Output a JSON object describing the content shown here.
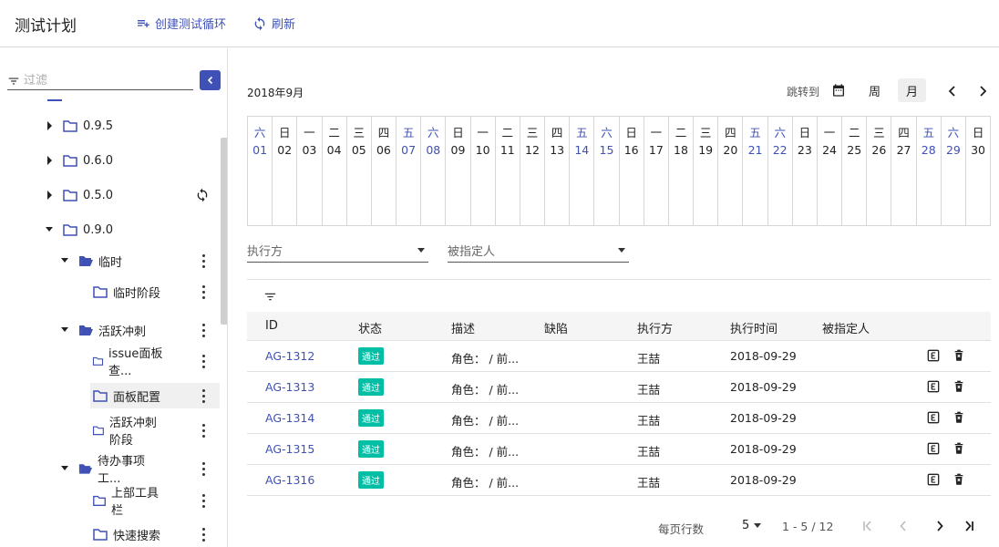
{
  "header": {
    "title": "测试计划",
    "create_cycle": "创建测试循环",
    "refresh": "刷新"
  },
  "sidebar": {
    "filter_placeholder": "过滤",
    "tree": [
      {
        "label": "0.9.5",
        "level": 1,
        "expanded": false
      },
      {
        "label": "0.6.0",
        "level": 1,
        "expanded": false
      },
      {
        "label": "0.5.0",
        "level": 1,
        "expanded": false
      },
      {
        "label": "0.9.0",
        "level": 1,
        "expanded": true
      },
      {
        "label": "临时",
        "level": 2,
        "expanded": true
      },
      {
        "label": "临时阶段",
        "level": 3
      },
      {
        "label": "活跃冲刺",
        "level": 2,
        "expanded": true
      },
      {
        "label": "issue面板查...",
        "level": 3
      },
      {
        "label": "面板配置",
        "level": 3,
        "selected": true
      },
      {
        "label": "活跃冲刺阶段",
        "level": 3
      },
      {
        "label": "待办事项工...",
        "level": 2,
        "expanded": true
      },
      {
        "label": "上部工具栏",
        "level": 3
      },
      {
        "label": "快速搜索",
        "level": 3
      }
    ]
  },
  "calendar": {
    "month": "2018年9月",
    "jump_to": "跳转到",
    "view_week": "周",
    "view_month": "月",
    "days": [
      {
        "w": "六",
        "d": "01",
        "weekend": true
      },
      {
        "w": "日",
        "d": "02",
        "weekend": false
      },
      {
        "w": "一",
        "d": "03",
        "weekend": false
      },
      {
        "w": "二",
        "d": "04",
        "weekend": false
      },
      {
        "w": "三",
        "d": "05",
        "weekend": false
      },
      {
        "w": "四",
        "d": "06",
        "weekend": false
      },
      {
        "w": "五",
        "d": "07",
        "weekend": true
      },
      {
        "w": "六",
        "d": "08",
        "weekend": true
      },
      {
        "w": "日",
        "d": "09",
        "weekend": false
      },
      {
        "w": "一",
        "d": "10",
        "weekend": false
      },
      {
        "w": "二",
        "d": "11",
        "weekend": false
      },
      {
        "w": "三",
        "d": "12",
        "weekend": false
      },
      {
        "w": "四",
        "d": "13",
        "weekend": false
      },
      {
        "w": "五",
        "d": "14",
        "weekend": true
      },
      {
        "w": "六",
        "d": "15",
        "weekend": true
      },
      {
        "w": "日",
        "d": "16",
        "weekend": false
      },
      {
        "w": "一",
        "d": "17",
        "weekend": false
      },
      {
        "w": "二",
        "d": "18",
        "weekend": false
      },
      {
        "w": "三",
        "d": "19",
        "weekend": false
      },
      {
        "w": "四",
        "d": "20",
        "weekend": false
      },
      {
        "w": "五",
        "d": "21",
        "weekend": true
      },
      {
        "w": "六",
        "d": "22",
        "weekend": true
      },
      {
        "w": "日",
        "d": "23",
        "weekend": false
      },
      {
        "w": "一",
        "d": "24",
        "weekend": false
      },
      {
        "w": "二",
        "d": "25",
        "weekend": false
      },
      {
        "w": "三",
        "d": "26",
        "weekend": false
      },
      {
        "w": "四",
        "d": "27",
        "weekend": false
      },
      {
        "w": "五",
        "d": "28",
        "weekend": true
      },
      {
        "w": "六",
        "d": "29",
        "weekend": true
      },
      {
        "w": "日",
        "d": "30",
        "weekend": false
      }
    ]
  },
  "filters": {
    "executor": "执行方",
    "assignee": "被指定人"
  },
  "table": {
    "headers": [
      "ID",
      "状态",
      "描述",
      "缺陷",
      "执行方",
      "执行时间",
      "被指定人"
    ],
    "rows": [
      {
        "id": "AG-1312",
        "status": "通过",
        "desc": "角色： / 前...",
        "defect": "",
        "executor": "王喆",
        "time": "2018-09-29",
        "assignee": ""
      },
      {
        "id": "AG-1313",
        "status": "通过",
        "desc": "角色： / 前...",
        "defect": "",
        "executor": "王喆",
        "time": "2018-09-29",
        "assignee": ""
      },
      {
        "id": "AG-1314",
        "status": "通过",
        "desc": "角色： / 前...",
        "defect": "",
        "executor": "王喆",
        "time": "2018-09-29",
        "assignee": ""
      },
      {
        "id": "AG-1315",
        "status": "通过",
        "desc": "角色： / 前...",
        "defect": "",
        "executor": "王喆",
        "time": "2018-09-29",
        "assignee": ""
      },
      {
        "id": "AG-1316",
        "status": "通过",
        "desc": "角色： / 前...",
        "defect": "",
        "executor": "王喆",
        "time": "2018-09-29",
        "assignee": ""
      }
    ]
  },
  "pager": {
    "rows_per_page_label": "每页行数",
    "rows_per_page": "5",
    "range": "1 - 5 / 12"
  },
  "colors": {
    "accent": "#3f51b5",
    "pass": "#00bfa5"
  }
}
